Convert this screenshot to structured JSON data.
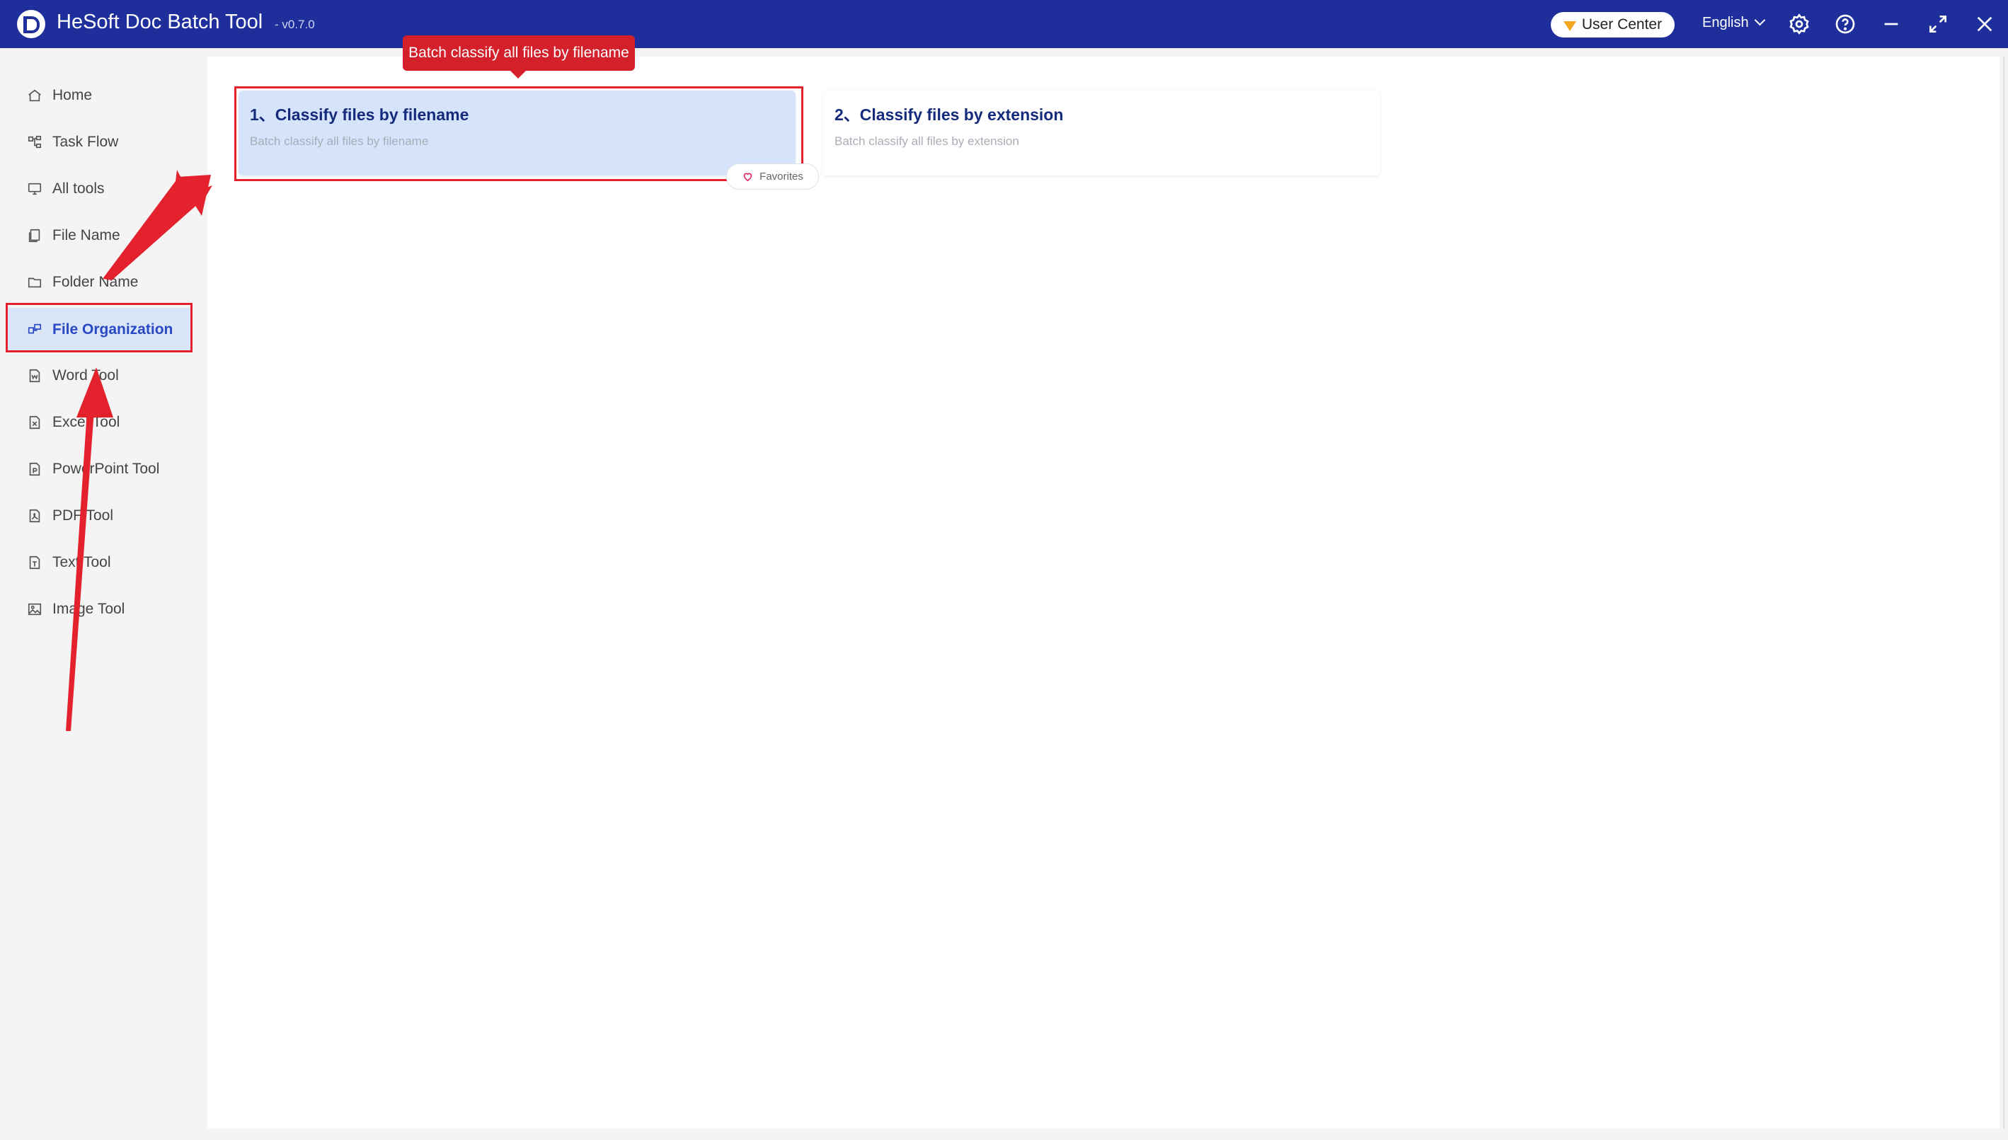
{
  "app": {
    "title": "HeSoft Doc Batch Tool",
    "version": "- v0.7.0",
    "user_center_label": "User Center",
    "language": "English"
  },
  "colors": {
    "titlebar": "#1e2f9c",
    "accent": "#2948c4",
    "annotation_red": "#e4222d",
    "selected_card": "#d6e4fb"
  },
  "sidebar": {
    "items": [
      {
        "label": "Home",
        "icon": "home-icon"
      },
      {
        "label": "Task Flow",
        "icon": "flow-icon"
      },
      {
        "label": "All tools",
        "icon": "monitor-icon"
      },
      {
        "label": "File Name",
        "icon": "file-copy-icon"
      },
      {
        "label": "Folder Name",
        "icon": "folder-icon"
      },
      {
        "label": "File Organization",
        "icon": "organize-icon",
        "active": true
      },
      {
        "label": "Word Tool",
        "icon": "word-doc-icon"
      },
      {
        "label": "Excel Tool",
        "icon": "excel-doc-icon"
      },
      {
        "label": "PowerPoint Tool",
        "icon": "ppt-doc-icon"
      },
      {
        "label": "PDF Tool",
        "icon": "pdf-doc-icon"
      },
      {
        "label": "Text Tool",
        "icon": "text-doc-icon"
      },
      {
        "label": "Image Tool",
        "icon": "image-icon"
      }
    ]
  },
  "main": {
    "tooltip": "Batch classify all files by filename",
    "cards": [
      {
        "title": "1、Classify files by filename",
        "desc": "Batch classify all files by filename",
        "selected": true
      },
      {
        "title": "2、Classify files by extension",
        "desc": "Batch classify all files by extension",
        "selected": false
      }
    ],
    "favorites_label": "Favorites"
  }
}
